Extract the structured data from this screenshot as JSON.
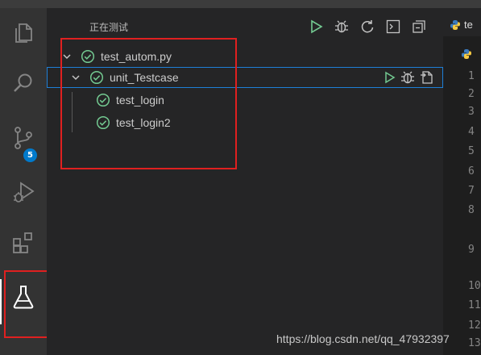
{
  "sidebar": {
    "title": "正在测试",
    "actions": [
      {
        "name": "run-all-tests",
        "icon": "play-icon"
      },
      {
        "name": "debug-all-tests",
        "icon": "debug-icon"
      },
      {
        "name": "refresh-tests",
        "icon": "refresh-icon"
      },
      {
        "name": "show-output",
        "icon": "terminal-icon"
      },
      {
        "name": "collapse-all",
        "icon": "collapse-all-icon"
      }
    ],
    "tree": {
      "file": {
        "label": "test_autom.py",
        "status": "passed"
      },
      "class": {
        "label": "unit_Testcase",
        "status": "passed"
      },
      "tests": [
        {
          "label": "test_login",
          "status": "passed"
        },
        {
          "label": "test_login2",
          "status": "passed"
        }
      ]
    }
  },
  "activity_bar": {
    "items": [
      "explorer-icon",
      "search-icon",
      "source-control-icon",
      "run-debug-icon",
      "extensions-icon",
      "testing-icon"
    ],
    "source_control_badge": "5"
  },
  "editor": {
    "tab_label": "te",
    "line_numbers": [
      "1",
      "2",
      "3",
      "4",
      "5",
      "6",
      "7",
      "8",
      "9",
      "10",
      "11",
      "12",
      "13"
    ]
  },
  "watermark": "https://blog.csdn.net/qq_47932397",
  "colors": {
    "pass_green": "#73c991",
    "accent_blue": "#007acc",
    "highlight_red": "#e02020"
  }
}
